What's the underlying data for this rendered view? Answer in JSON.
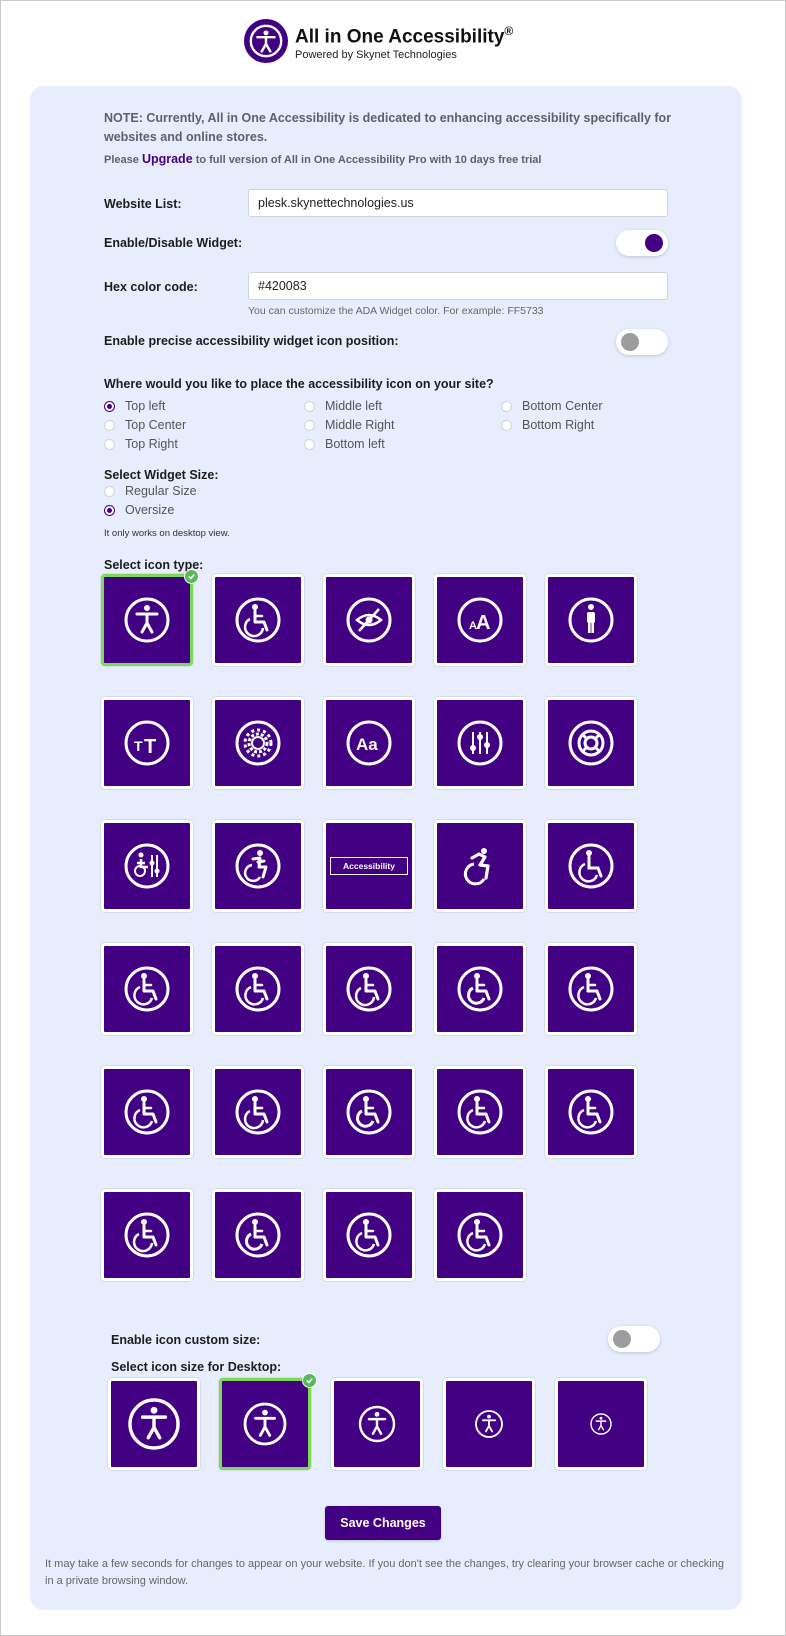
{
  "brand": {
    "title": "All in One Accessibility",
    "reg": "®",
    "subtitle": "Powered by Skynet Technologies",
    "color": "#420083"
  },
  "note": {
    "main": "NOTE: Currently, All in One Accessibility is dedicated to enhancing accessibility specifically for websites and online stores.",
    "prefix": "Please",
    "link": "Upgrade",
    "suffix": "to full version of All in One Accessibility Pro with 10 days free trial"
  },
  "website_list": {
    "label": "Website List:",
    "value": "plesk.skynettechnologies.us"
  },
  "widget_toggle": {
    "label": "Enable/Disable Widget:",
    "on": true
  },
  "hex": {
    "label": "Hex color code:",
    "value": "#420083",
    "help": "You can customize the ADA Widget color. For example: FF5733"
  },
  "precise": {
    "label": "Enable precise accessibility widget icon position:",
    "on": false
  },
  "position": {
    "label": "Where would you like to place the accessibility icon on your site?",
    "options": [
      "Top left",
      "Top Center",
      "Top Right",
      "Middle left",
      "Middle Right",
      "Bottom left",
      "Bottom Center",
      "Bottom Right"
    ],
    "selected": "Top left"
  },
  "size": {
    "label": "Select Widget Size:",
    "options": [
      "Regular Size",
      "Oversize"
    ],
    "selected": "Oversize",
    "note": "It only works on desktop view."
  },
  "icon_type": {
    "label": "Select icon type:",
    "selected_index": 0,
    "tiles": [
      "person-accessibility-icon",
      "wheelchair-icon",
      "eye-slash-icon",
      "text-size-icon",
      "person-standing-icon",
      "text-height-icon",
      "gear-icon",
      "aa-font-icon",
      "sliders-icon",
      "lifebuoy-icon",
      "person-settings-icon",
      "wheelchair-dynamic-icon",
      "accessibility-label",
      "wheelchair-dynamic-alt-icon",
      "wheelchair-circle-icon",
      "wheelchair-icon",
      "wheelchair-icon",
      "wheelchair-icon",
      "wheelchair-icon",
      "wheelchair-icon",
      "wheelchair-icon",
      "wheelchair-icon",
      "wheelchair-icon",
      "wheelchair-icon",
      "wheelchair-icon",
      "wheelchair-icon",
      "wheelchair-icon",
      "wheelchair-icon",
      "wheelchair-icon"
    ],
    "accessibility_label": "Accessibility"
  },
  "custom_size": {
    "label": "Enable icon custom size:",
    "on": false
  },
  "desktop_size": {
    "label": "Select icon size for Desktop:",
    "selected_index": 1,
    "sizes": [
      "extra-large",
      "large",
      "medium",
      "small",
      "extra-small"
    ]
  },
  "save_label": "Save Changes",
  "footer_note": "It may take a few seconds for changes to appear on your website. If you don't see the changes, try clearing your browser cache or checking in a private browsing window."
}
